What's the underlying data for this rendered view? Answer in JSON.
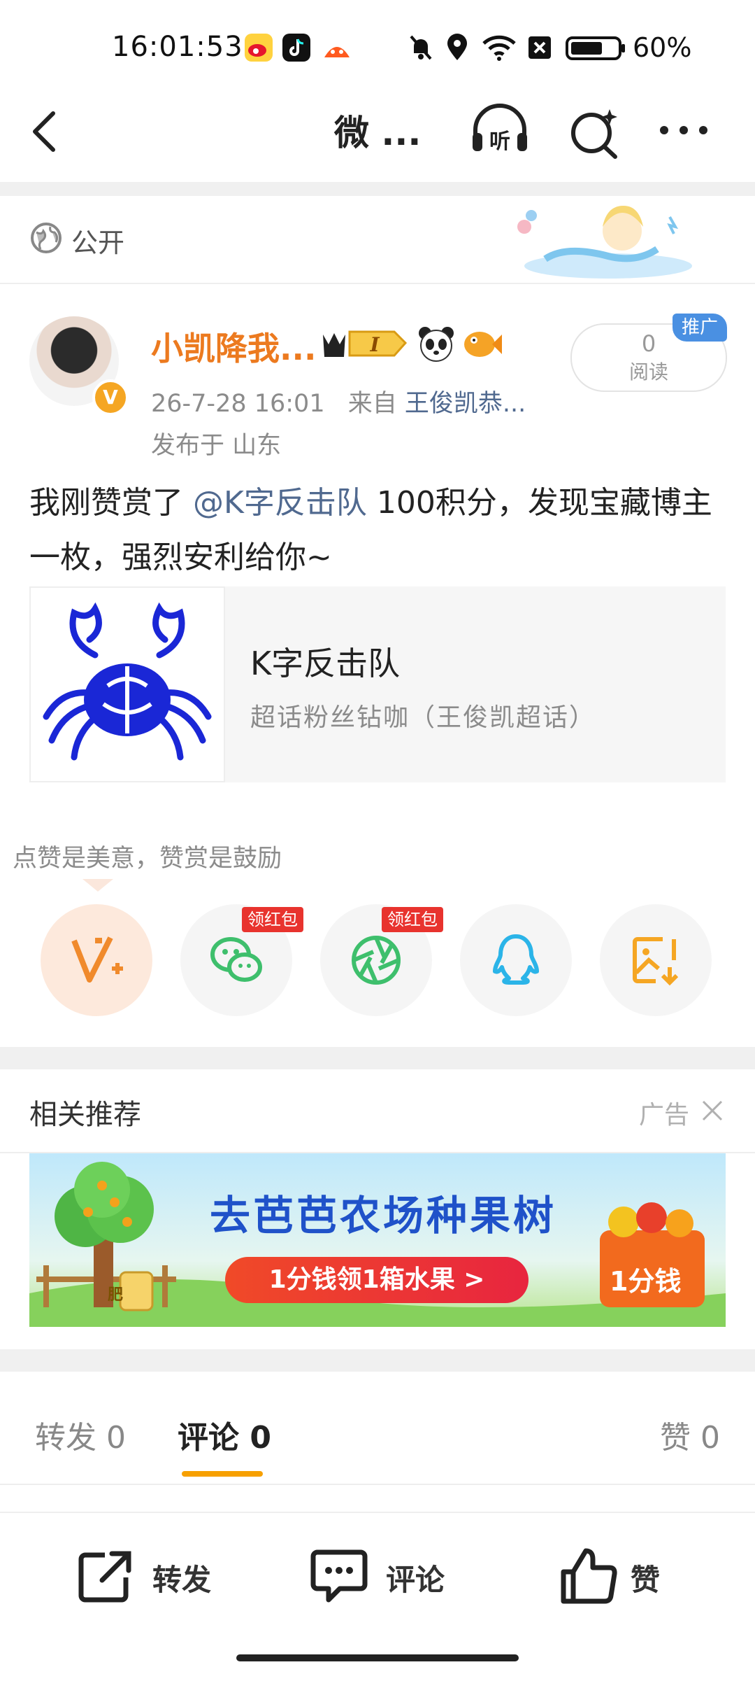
{
  "status_bar": {
    "time": "16:01:53",
    "battery": "60%"
  },
  "nav": {
    "title": "微 ..."
  },
  "post_header": {
    "visibility": "公开"
  },
  "user": {
    "name": "小凯降我...",
    "level_badge": "I",
    "verified_badge": "V",
    "time": "26-7-28 16:01",
    "from_label": "来自",
    "source": "王俊凯恭...",
    "location": "发布于 山东"
  },
  "read_stats": {
    "count": "0",
    "label": "阅读",
    "promo_tag": "推广"
  },
  "post": {
    "text_before": "我刚赞赏了 ",
    "mention": "@K字反击队",
    "text_after": " 100积分，发现宝藏博主一枚，强烈安利给你~"
  },
  "card": {
    "title": "K字反击队",
    "subtitle": "超话粉丝钻咖（王俊凯超话）"
  },
  "share": {
    "tip": "点赞是美意，赞赏是鼓励",
    "redpacket_label": "领红包",
    "buttons": [
      "weibo-reward-icon",
      "wechat-icon",
      "moments-icon",
      "qq-icon",
      "save-image-icon"
    ]
  },
  "recommend": {
    "title": "相关推荐",
    "ad_label": "广告",
    "banner": {
      "title": "去芭芭农场种果树",
      "cta": "1分钱领1箱水果 >",
      "price": "1分钱",
      "sign": "肥"
    }
  },
  "tabs": [
    {
      "label": "转发 0"
    },
    {
      "label": "评论 0"
    },
    {
      "label": "赞 0"
    }
  ],
  "bottom_bar": {
    "repost": "转发",
    "comment": "评论",
    "like": "赞"
  },
  "colors": {
    "accent": "#f7a000",
    "username": "#ec7a1f",
    "link": "#50698f",
    "redpacket": "#e8332e"
  }
}
